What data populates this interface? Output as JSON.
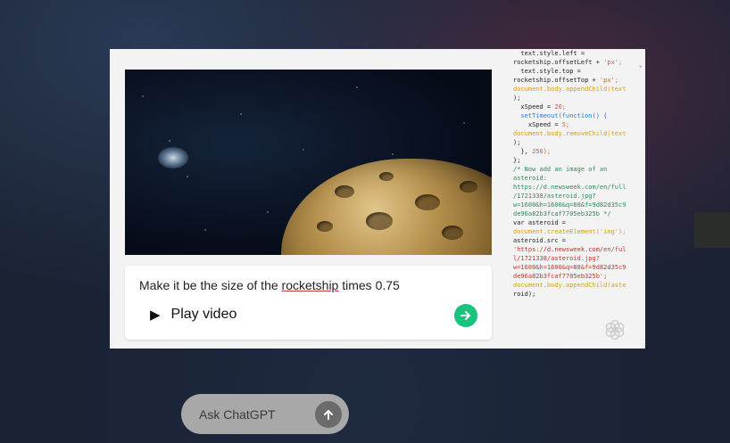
{
  "demo": {
    "prompt_prefix": "Make it be the size of the ",
    "prompt_underlined": "rocketship",
    "prompt_suffix": " times 0.75",
    "play_glyph": "▶",
    "play_label": "Play video",
    "send_icon": "arrow-right-icon",
    "accent_color": "#19c37d"
  },
  "code_panel": {
    "lines": [
      [
        "  text.style.left =",
        ""
      ],
      [
        "rocketship.offsetLeft + ",
        "'px';"
      ],
      [
        "  text.style.top =",
        ""
      ],
      [
        "rocketship.offsetTop + ",
        "'px';"
      ],
      [
        "",
        ""
      ],
      [
        "document.body.appendChild(text",
        ""
      ],
      [
        ");",
        ""
      ],
      [
        "  xSpeed = ",
        "20;"
      ],
      [
        "  setTimeout(function() {",
        ""
      ],
      [
        "    xSpeed = ",
        "5;"
      ],
      [
        "",
        ""
      ],
      [
        "document.body.removeChild(text",
        ""
      ],
      [
        ");",
        ""
      ],
      [
        "  }, ",
        "250);"
      ],
      [
        "};",
        ""
      ],
      [
        "",
        ""
      ],
      [
        "",
        ""
      ],
      [
        "/* Now add an image of an",
        ""
      ],
      [
        "asteroid:",
        ""
      ],
      [
        "https://d.newsweek.com/en/full",
        ""
      ],
      [
        "/1721338/asteroid.jpg?",
        ""
      ],
      [
        "w=1600&h=1600&q=88&f=9d82d35c9",
        ""
      ],
      [
        "de96a82b3fcaf7705eb325b */",
        ""
      ],
      [
        "var asteroid =",
        ""
      ],
      [
        "document.createElement('img');",
        ""
      ],
      [
        "asteroid.src =",
        ""
      ],
      [
        "'https://d.newsweek.com/en/ful",
        ""
      ],
      [
        "l/1721338/asteroid.jpg?",
        ""
      ],
      [
        "w=1600&h=1600&q=88&f=9d82d35c9",
        ""
      ],
      [
        "de96a82b3fcaf7705eb325b';",
        ""
      ],
      [
        "document.body.appendChild(aste",
        ""
      ],
      [
        "roid);",
        ""
      ]
    ],
    "scroll_marker": "+"
  },
  "ask_bar": {
    "placeholder": "Ask ChatGPT",
    "send_icon": "arrow-up-icon"
  }
}
